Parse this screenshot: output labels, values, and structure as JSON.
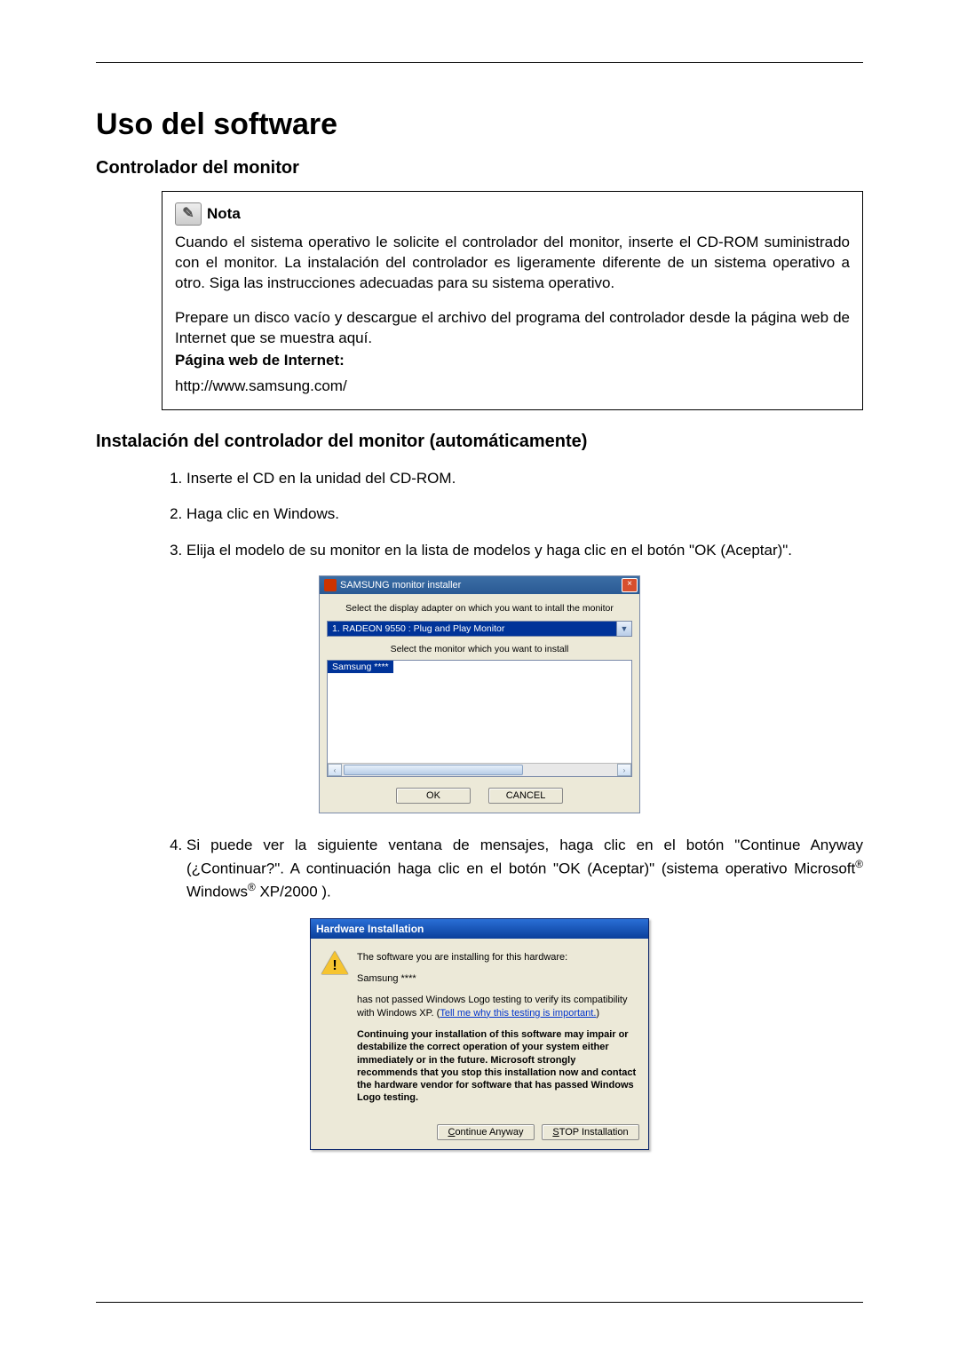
{
  "doc": {
    "h1": "Uso del software",
    "h2_monitor_driver": "Controlador del monitor",
    "note": {
      "label": "Nota",
      "p1": "Cuando el sistema operativo le solicite el controlador del monitor, inserte el CD-ROM suministrado con el monitor. La instalación del controlador es ligeramente diferente de un sistema operativo a otro. Siga las instrucciones adecuadas para su sistema operativo.",
      "p2": "Prepare un disco vacío y descargue el archivo del programa del controlador desde la página web de Internet que se muestra aquí.",
      "website_label": "Página web de Internet:",
      "url": "http://www.samsung.com/"
    },
    "h3_auto_install": "Instalación del controlador del monitor (automáticamente)",
    "steps": {
      "s1": "Inserte el CD en la unidad del CD-ROM.",
      "s2": "Haga clic en Windows.",
      "s3": "Elija el modelo de su monitor en la lista de modelos y haga clic en el botón \"OK (Aceptar)\".",
      "s4_pre": "Si puede ver la siguiente ventana de mensajes, haga clic en el botón \"Continue Anyway (¿Continuar?\". A continuación haga clic en el botón \"OK (Aceptar)\" (sistema operativo Microsoft",
      "s4_reg1": "®",
      "s4_mid": " Windows",
      "s4_reg2": "®",
      "s4_post": " XP/2000 )."
    }
  },
  "dlg1": {
    "title": "SAMSUNG monitor installer",
    "close": "×",
    "label_adapter": "Select the display adapter on which you want to intall the monitor",
    "combo_value": "1. RADEON 9550 : Plug and Play Monitor",
    "combo_arrow": "▼",
    "label_select_monitor": "Select the monitor which you want to install",
    "list_item": "Samsung ****",
    "hscroll_left": "‹",
    "hscroll_right": "›",
    "ok": "OK",
    "cancel": "CANCEL"
  },
  "dlg2": {
    "title": "Hardware Installation",
    "line1": "The software you are installing for this hardware:",
    "hardware": "Samsung ****",
    "line2_pre": "has not passed Windows Logo testing to verify its compatibility with Windows XP. (",
    "link": "Tell me why this testing is important.",
    "line2_post": ")",
    "bold_block": "Continuing your installation of this software may impair or destabilize the correct operation of your system either immediately or in the future. Microsoft strongly recommends that you stop this installation now and contact the hardware vendor for software that has passed Windows Logo testing.",
    "continue_u": "C",
    "continue_rest": "ontinue Anyway",
    "stop_u": "S",
    "stop_rest": "TOP Installation"
  }
}
